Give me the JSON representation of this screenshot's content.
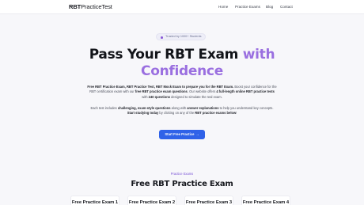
{
  "nav": {
    "logo_bold": "RBT",
    "logo_rest": "PracticeTest",
    "links": [
      "Home",
      "Practice Exams",
      "Blog",
      "Contact"
    ]
  },
  "hero": {
    "badge": "Trusted by 1000+ Students",
    "title_main": "Pass Your RBT Exam",
    "title_accent_1": "with",
    "title_accent_2": "Confidence",
    "p1_bold1": "Free RBT Practice Exam, RBT Practice Test, RBT Mock Exam to prepare you for the RBT Exam.",
    "p1_text1": " Boost your confidence for the RBT certification exam with our ",
    "p1_bold2": "free RBT practice exam questions",
    "p1_text2": ". Our website offers ",
    "p1_bold3": "4 full-length online RBT practice tests",
    "p1_text3": " with ",
    "p1_bold4": "240 questions",
    "p1_text4": " designed to simulate the real exam.",
    "p2_text1": "Each test includes ",
    "p2_bold1": "challenging, exam-style questions",
    "p2_text2": " along with ",
    "p2_bold2": "answer explanations",
    "p2_text3": " to help you understand key concepts. ",
    "p2_bold3": "Start studying today",
    "p2_text4": " by clicking on any of the ",
    "p2_bold4": "RBT practice exams below",
    "p2_text5": "!",
    "cta_label": "Start Free Practice",
    "cta_arrow": "→"
  },
  "section": {
    "eyebrow": "Practice Exams",
    "title": "Free RBT Practice Exam",
    "cards": [
      "Free Practice Exam 1",
      "Free Practice Exam 2",
      "Free Practice Exam 3",
      "Free Practice Exam 4"
    ]
  },
  "colors": {
    "accent_purple": "#9a6fe0",
    "cta_blue": "#2f62e8",
    "background": "#f7f7fa"
  },
  "icons": {
    "badge_dot": "status-dot-icon",
    "cta_arrow": "arrow-right-icon"
  }
}
